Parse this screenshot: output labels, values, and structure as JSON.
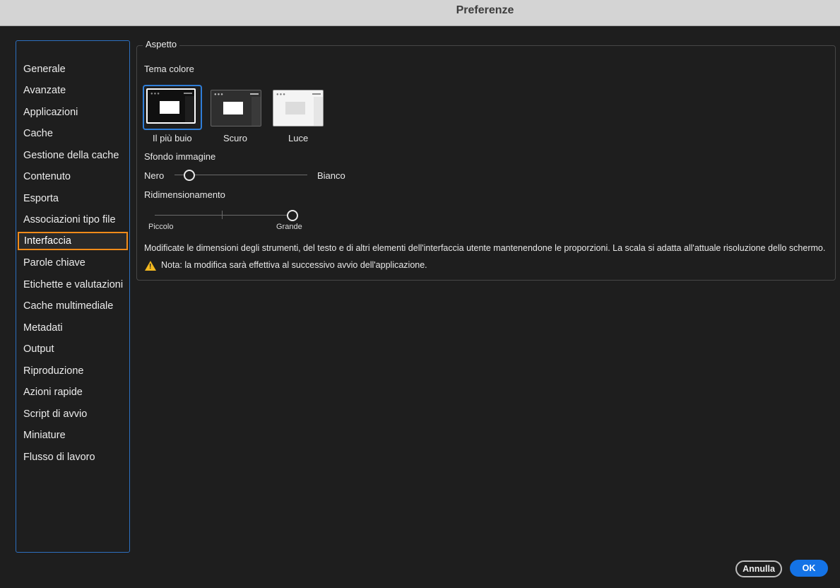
{
  "window": {
    "title": "Preferenze"
  },
  "sidebar": {
    "items": [
      {
        "label": "Generale"
      },
      {
        "label": "Avanzate"
      },
      {
        "label": "Applicazioni"
      },
      {
        "label": "Cache"
      },
      {
        "label": "Gestione della cache"
      },
      {
        "label": "Contenuto"
      },
      {
        "label": "Esporta"
      },
      {
        "label": "Associazioni tipo file"
      },
      {
        "label": "Interfaccia",
        "selected": true
      },
      {
        "label": "Parole chiave"
      },
      {
        "label": "Etichette e valutazioni"
      },
      {
        "label": "Cache multimediale"
      },
      {
        "label": "Metadati"
      },
      {
        "label": "Output"
      },
      {
        "label": "Riproduzione"
      },
      {
        "label": "Azioni rapide"
      },
      {
        "label": "Script di avvio"
      },
      {
        "label": "Miniature"
      },
      {
        "label": "Flusso di lavoro"
      }
    ]
  },
  "appearance": {
    "group_title": "Aspetto",
    "theme_label": "Tema colore",
    "themes": [
      {
        "label": "Il più buio",
        "selected": true
      },
      {
        "label": "Scuro"
      },
      {
        "label": "Luce"
      }
    ],
    "image_background": {
      "label": "Sfondo immagine",
      "min_label": "Nero",
      "max_label": "Bianco",
      "value_fraction": 0.11
    },
    "scaling": {
      "label": "Ridimensionamento",
      "min_label": "Piccolo",
      "max_label": "Grande",
      "value_fraction": 1.0
    },
    "description": "Modificate le dimensioni degli strumenti, del testo e di altri elementi dell'interfaccia utente mantenendone le proporzioni. La scala si adatta all'attuale risoluzione dello schermo.",
    "note": "Nota: la modifica sarà effettiva al successivo avvio dell'applicazione."
  },
  "buttons": {
    "cancel": "Annulla",
    "ok": "OK"
  },
  "colors": {
    "accent": "#1473e6",
    "selection_outline": "#f18b1a",
    "warning": "#f2b81f"
  }
}
